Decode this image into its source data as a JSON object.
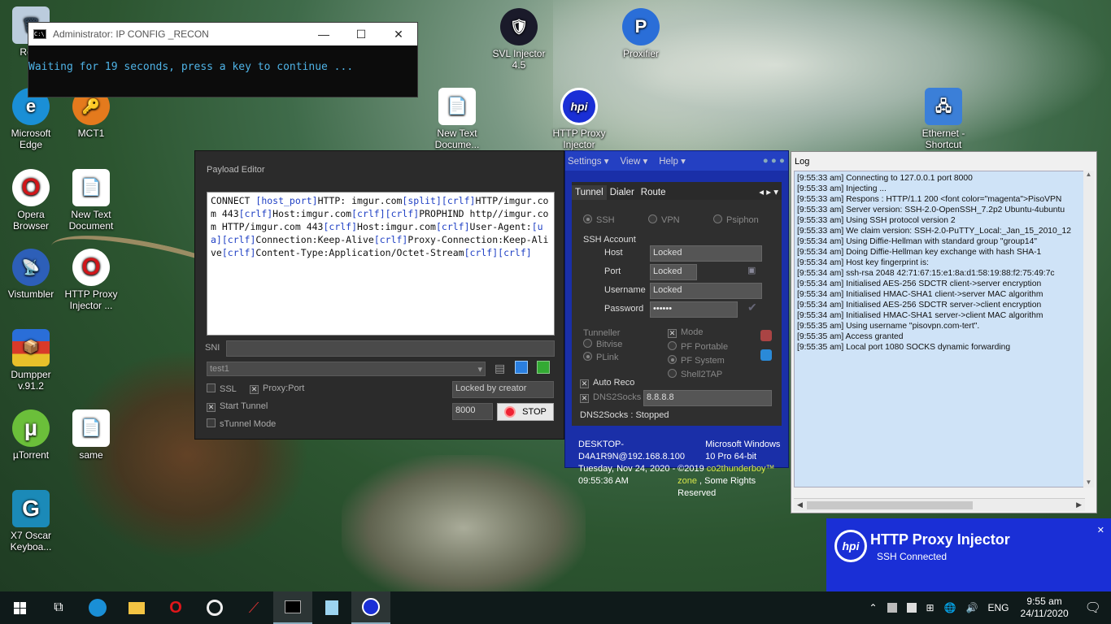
{
  "desktop": {
    "icons": [
      {
        "label": "Recy",
        "glyph": "🗑"
      },
      {
        "label": "Microsoft Edge",
        "glyph": "e"
      },
      {
        "label": "MCT1",
        "glyph": "🔑"
      },
      {
        "label": "Opera Browser",
        "glyph": "O"
      },
      {
        "label": "New Text Document",
        "glyph": "📄"
      },
      {
        "label": "Vistumbler",
        "glyph": "📡"
      },
      {
        "label": "HTTP Proxy Injector ...",
        "glyph": "O"
      },
      {
        "label": "Dumpper v.91.2",
        "glyph": "📦"
      },
      {
        "label": "µTorrent",
        "glyph": "µ"
      },
      {
        "label": "same",
        "glyph": "📄"
      },
      {
        "label": "X7 Oscar Keyboa...",
        "glyph": "G"
      },
      {
        "label": "SVL Injector 4.5",
        "glyph": "🛡"
      },
      {
        "label": "Proxifier",
        "glyph": "P"
      },
      {
        "label": "New Text Docume...",
        "glyph": "📄"
      },
      {
        "label": "HTTP Proxy Injector",
        "glyph": "hpi"
      },
      {
        "label": "Ethernet - Shortcut",
        "glyph": "🖧"
      }
    ]
  },
  "cmd": {
    "title": "Administrator:  IP CONFIG _RECON",
    "text": "Waiting for 19 seconds, press a key to continue ..."
  },
  "payload_editor": {
    "title": "Payload Editor",
    "payload_segments": [
      {
        "t": "CONNECT ",
        "c": "n"
      },
      {
        "t": "[host_port]",
        "c": "t"
      },
      {
        "t": "HTTP: imgur.com",
        "c": "n"
      },
      {
        "t": "[split]",
        "c": "t"
      },
      {
        "t": "[crlf]",
        "c": "t"
      },
      {
        "t": "HTTP/imgur.com 443",
        "c": "n"
      },
      {
        "t": "[crlf]",
        "c": "t"
      },
      {
        "t": "Host:imgur.com",
        "c": "n"
      },
      {
        "t": "[crlf]",
        "c": "t"
      },
      {
        "t": "[crlf]",
        "c": "t"
      },
      {
        "t": "PROPHIND http//imgur.com HTTP/imgur.com 443",
        "c": "n"
      },
      {
        "t": "[crlf]",
        "c": "t"
      },
      {
        "t": "Host:imgur.com",
        "c": "n"
      },
      {
        "t": "[crlf]",
        "c": "t"
      },
      {
        "t": "User-Agent:",
        "c": "n"
      },
      {
        "t": "[ua]",
        "c": "t"
      },
      {
        "t": "[crlf]",
        "c": "t"
      },
      {
        "t": "Connection:Keep-Alive",
        "c": "n"
      },
      {
        "t": "[crlf]",
        "c": "t"
      },
      {
        "t": "Proxy-Connection:Keep-Alive",
        "c": "n"
      },
      {
        "t": "[crlf]",
        "c": "t"
      },
      {
        "t": "Content-Type:Application/Octet-Stream",
        "c": "n"
      },
      {
        "t": "[crlf]",
        "c": "t"
      },
      {
        "t": "[crlf]",
        "c": "t"
      }
    ],
    "sni_label": "SNI",
    "sni_value": "",
    "profile_value": "test1",
    "ssl_label": "SSL",
    "proxy_port_label": "Proxy:Port",
    "start_tunnel_label": "Start Tunnel",
    "stunnel_label": "sTunnel Mode",
    "locked_value": "Locked by creator",
    "port_value": "8000",
    "stop_label": "STOP"
  },
  "hpi": {
    "menu": [
      "Settings ▾",
      "View ▾",
      "Help ▾"
    ],
    "tabs": [
      "Tunnel",
      "Dialer",
      "Route"
    ],
    "modes": [
      "SSH",
      "VPN",
      "Psiphon"
    ],
    "ssh_account_label": "SSH Account",
    "host_label": "Host",
    "host_value": "Locked",
    "port_label": "Port",
    "port_value": "Locked",
    "username_label": "Username",
    "username_value": "Locked",
    "password_label": "Password",
    "password_value": "••••••",
    "tunneller_label": "Tunneller",
    "bitvise_label": "Bitvise",
    "plink_label": "PLink",
    "mode_label": "Mode",
    "pf_portable_label": "PF Portable",
    "pf_system_label": "PF System",
    "shell2tap_label": "Shell2TAP",
    "auto_reco_label": "Auto Reco",
    "dns2socks_label": "DNS2Socks",
    "dns_value": "8.8.8.8",
    "status": "DNS2Socks : Stopped",
    "footer_host": "DESKTOP-D4A1R9N@192.168.8.100",
    "footer_os": "Microsoft Windows 10 Pro 64-bit",
    "footer_date": "Tuesday, Nov 24, 2020 - 09:55:36 AM",
    "footer_copy_pre": "©2019 ",
    "footer_copy_brand": "co2thunderboy™ zone",
    "footer_copy_post": " , Some Rights Reserved"
  },
  "log": {
    "title": "Log",
    "lines": [
      "[9:55:33 am] Connecting to 127.0.0.1 port 8000",
      "[9:55:33 am] Injecting ...",
      "[9:55:33 am] Respons : HTTP/1.1 200 <font color=\"magenta\">PisoVPN",
      "[9:55:33 am] Server version: SSH-2.0-OpenSSH_7.2p2 Ubuntu-4ubuntu",
      "[9:55:33 am] Using SSH protocol version 2",
      "[9:55:33 am] We claim version: SSH-2.0-PuTTY_Local:_Jan_15_2010_12",
      "[9:55:34 am] Using Diffie-Hellman with standard group \"group14\"",
      "[9:55:34 am] Doing Diffie-Hellman key exchange with hash SHA-1",
      "[9:55:34 am] Host key fingerprint is:",
      "[9:55:34 am] ssh-rsa 2048 42:71:67:15:e1:8a:d1:58:19:88:f2:75:49:7c",
      "[9:55:34 am] Initialised AES-256 SDCTR client->server encryption",
      "[9:55:34 am] Initialised HMAC-SHA1 client->server MAC algorithm",
      "[9:55:34 am] Initialised AES-256 SDCTR server->client encryption",
      "[9:55:34 am] Initialised HMAC-SHA1 server->client MAC algorithm",
      "[9:55:35 am] Using username \"pisovpn.com-tert\".",
      "[9:55:35 am] Access granted",
      "[9:55:35 am] Local port 1080 SOCKS dynamic forwarding"
    ]
  },
  "toast": {
    "title": "HTTP Proxy Injector",
    "subtitle": "SSH Connected",
    "logo": "hpi"
  },
  "taskbar": {
    "lang": "ENG",
    "time": "9:55 am",
    "date": "24/11/2020"
  }
}
